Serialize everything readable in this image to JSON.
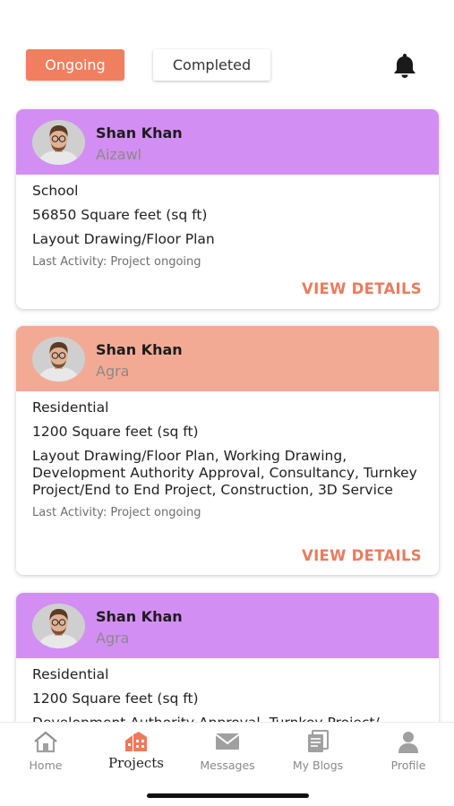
{
  "tabs": {
    "ongoing": "Ongoing",
    "completed": "Completed"
  },
  "colors": {
    "accent": "#f07f60",
    "card_purple": "#d38ef3",
    "card_salmon": "#f3aa95",
    "link": "#ec7a5d"
  },
  "projects": [
    {
      "name": "Shan Khan",
      "city": "Aizawl",
      "type": "School",
      "area": "56850 Square feet (sq ft)",
      "services": "Layout Drawing/Floor Plan",
      "activity": "Last Activity: Project ongoing",
      "action": "VIEW DETAILS",
      "header_color": "purple"
    },
    {
      "name": "Shan Khan",
      "city": "Agra",
      "type": "Residential",
      "area": "1200 Square feet (sq ft)",
      "services": "Layout Drawing/Floor Plan, Working Drawing, Development Authority Approval, Consultancy, Turnkey Project/End to End Project, Construction, 3D Service",
      "activity": "Last Activity: Project ongoing",
      "action": "VIEW DETAILS",
      "header_color": "salmon"
    },
    {
      "name": "Shan Khan",
      "city": "Agra",
      "type": "Residential",
      "area": "1200 Square feet (sq ft)",
      "services": "Development Authority Approval, Turnkey Project/",
      "header_color": "purple"
    }
  ],
  "nav": [
    {
      "label": "Home",
      "icon": "home-icon"
    },
    {
      "label": "Projects",
      "icon": "projects-icon",
      "active": true
    },
    {
      "label": "Messages",
      "icon": "mail-icon"
    },
    {
      "label": "My Blogs",
      "icon": "blogs-icon"
    },
    {
      "label": "Profile",
      "icon": "profile-icon"
    }
  ]
}
